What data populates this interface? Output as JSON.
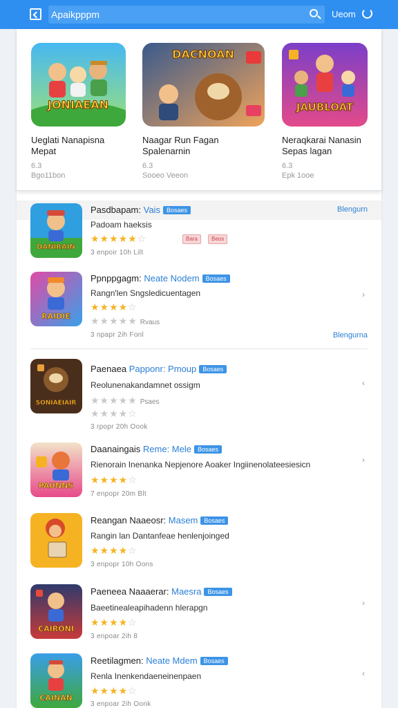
{
  "topbar": {
    "search_value": "Apaikpppm",
    "user_label": "Ueom"
  },
  "featured": [
    {
      "art": "JONIAEAN",
      "title1": "Ueglati Nanapisna",
      "title2": "Mepat",
      "rating": "6.3",
      "meta": "Bgo11bon"
    },
    {
      "art": "DACNOAN",
      "title1": "Naagar Run Fagan",
      "title2": "Spalenarnin",
      "rating": "6.3",
      "meta": "Sooeo Veeon"
    },
    {
      "art": "JAUBLOAT",
      "title1": "Neraqkarai Nanasin",
      "title2": "Sepas lagan",
      "rating": "6.3",
      "meta": "Epk 1ooe"
    }
  ],
  "list_header": {
    "link_label": "Blengurn"
  },
  "rows": [
    {
      "art": "DANIRAIN",
      "title": "Pasdbapam:",
      "title_hl": "Vais",
      "badge": "Bosaes",
      "desc": "Padoam haeksis",
      "rating_text": "",
      "meta": "3 enpoir 10h  Lilt",
      "pills": [
        "Bara",
        "Beos"
      ]
    },
    {
      "art": "RAIDIE",
      "title": "Ppnppgagm:",
      "title_hl": "Neate Nodem",
      "badge": "Bosaes",
      "desc": "Rangn'len Sngsledicuentagen",
      "rating_text": "Rvaus",
      "meta": "3  npapr 2ih  Fonl",
      "link": "Blengurna"
    },
    {
      "art": "SONIAEIAIR",
      "title": "Paenaea",
      "title_hl": "Papponr: Pmoup",
      "badge": "Bosaes",
      "desc": "Reolunenakandamnet ossigm",
      "rating_text": "Psaes",
      "meta": "3 rpopr 20h  Oook"
    },
    {
      "art": "PAUNNS",
      "title": "Daanaingais",
      "title_hl": "Reme: Mele",
      "badge": "Bosaes",
      "desc": "Rienorain  Inenanka Nepjenore Aoaker Ingiinenolateesiesicn",
      "rating_text": "",
      "meta": "7 enpopr 20m  Blt"
    },
    {
      "art": "",
      "title": "Reangan Naaeosr:",
      "title_hl": "Masem",
      "badge": "Bosaes",
      "desc": "Rangin lan Dantanfeae henlenjoinged",
      "rating_text": "",
      "meta": "3  enpopr 10h  Oons"
    },
    {
      "art": "CAIRONI",
      "title": "Paeneea Naaaerar:",
      "title_hl": "Maesra",
      "badge": "Bosaes",
      "desc": "Baeetinealeapihadenn hlerapgn",
      "rating_text": "",
      "meta": "3  enpoar 2ih  8"
    },
    {
      "art": "CAINAN",
      "title": "Reetilagmen:",
      "title_hl": "Neate Mdem",
      "badge": "Bosaes",
      "desc": "Renla Inenkendaeneinenpaen",
      "rating_text": "",
      "meta": "3 enpoar 2ih  Oonk"
    }
  ],
  "colors": {
    "topbar": "#2f8ff0",
    "accent_link": "#2b7fd6",
    "badge": "#3d94e6",
    "star": "#f5b324"
  }
}
